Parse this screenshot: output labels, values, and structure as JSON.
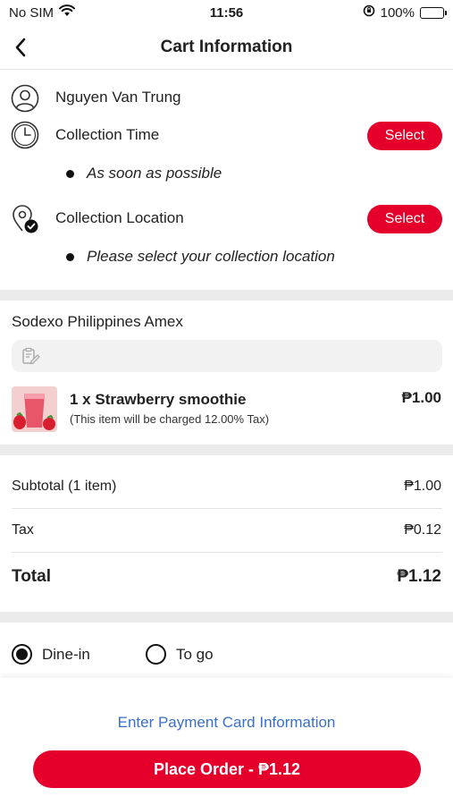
{
  "status_bar": {
    "carrier": "No SIM",
    "time": "11:56",
    "battery_percent": "100%"
  },
  "header": {
    "title": "Cart Information",
    "back_icon": "chevron-left-icon"
  },
  "customer": {
    "name": "Nguyen Van Trung",
    "icon": "user-icon"
  },
  "collection_time": {
    "label": "Collection Time",
    "button": "Select",
    "value": "As soon as possible",
    "icon": "clock-icon"
  },
  "collection_location": {
    "label": "Collection Location",
    "button": "Select",
    "value": "Please select your collection location",
    "icon": "location-check-icon"
  },
  "store": {
    "name": "Sodexo Philippines Amex",
    "note_icon": "clipboard-edit-icon",
    "note_placeholder": ""
  },
  "items": [
    {
      "name": "1 x Strawberry smoothie",
      "note": "(This item will be charged 12.00% Tax)",
      "price": "₱1.00"
    }
  ],
  "totals": {
    "subtotal_label": "Subtotal (1 item)",
    "subtotal_value": "₱1.00",
    "tax_label": "Tax",
    "tax_value": "₱0.12",
    "total_label": "Total",
    "total_value": "₱1.12"
  },
  "order_type": {
    "options": [
      "Dine-in",
      "To go"
    ],
    "selected": "Dine-in"
  },
  "footer": {
    "payment_link": "Enter Payment Card Information",
    "place_order": "Place Order - ₱1.12"
  },
  "colors": {
    "accent": "#e4002b",
    "link": "#3b6fc9",
    "separator": "#ebebeb"
  }
}
